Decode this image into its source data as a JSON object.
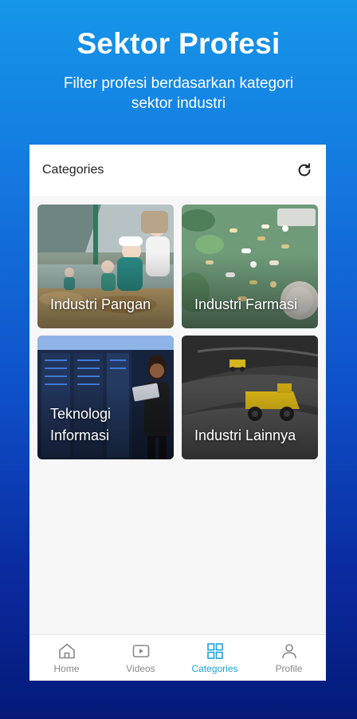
{
  "promo": {
    "title": "Sektor Profesi",
    "subtitle": "Filter profesi berdasarkan kategori sektor industri"
  },
  "header": {
    "title": "Categories",
    "refresh_icon": "refresh-icon"
  },
  "categories": [
    {
      "label": "Industri Pangan",
      "image": "food-industry-workers-photo"
    },
    {
      "label": "Industri Farmasi",
      "image": "pharmaceutical-pills-photo"
    },
    {
      "label": "Teknologi Informasi",
      "image": "server-room-laptop-photo"
    },
    {
      "label": "Industri Lainnya",
      "image": "mining-trucks-photo"
    }
  ],
  "nav": [
    {
      "label": "Home",
      "icon": "home-icon",
      "active": false
    },
    {
      "label": "Videos",
      "icon": "video-icon",
      "active": false
    },
    {
      "label": "Categories",
      "icon": "grid-icon",
      "active": true
    },
    {
      "label": "Profile",
      "icon": "person-icon",
      "active": false
    }
  ],
  "colors": {
    "active": "#1aa3e0",
    "inactive": "#888888"
  }
}
